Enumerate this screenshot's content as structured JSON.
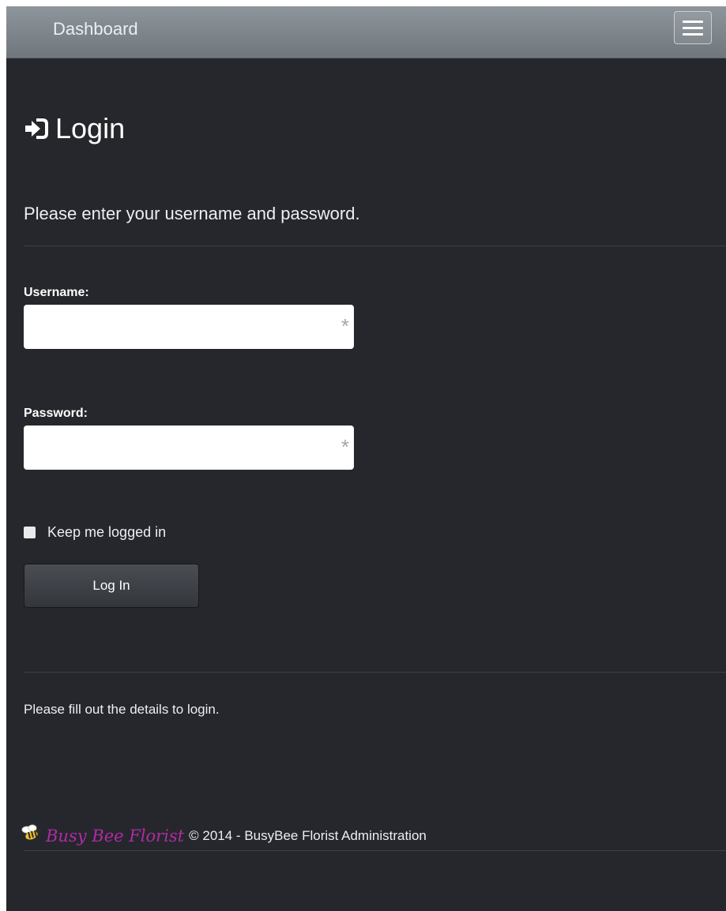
{
  "navbar": {
    "brand": "Dashboard",
    "menu_icon": "hamburger-menu-icon"
  },
  "login": {
    "title": "Login",
    "title_icon": "login-arrow-icon",
    "intro": "Please enter your username and password.",
    "username_label": "Username:",
    "username_value": "",
    "password_label": "Password:",
    "password_value": "",
    "required_marker": "*",
    "remember_label": "Keep me logged in",
    "remember_checked": false,
    "submit_label": "Log In",
    "status_message": "Please fill out the details to login."
  },
  "footer": {
    "logo_text": "Busy Bee Florist",
    "logo_icon": "bee-logo-icon",
    "copyright": "© 2014 - BusyBee Florist Administration"
  },
  "colors": {
    "navbar": "#7f878d",
    "background": "#25272c",
    "logo_accent": "#b22aa6"
  }
}
